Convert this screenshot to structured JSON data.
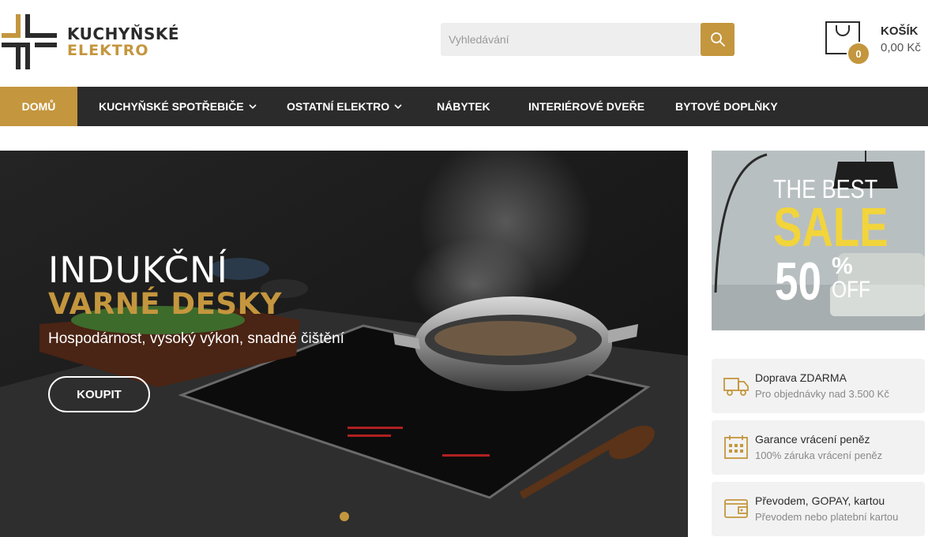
{
  "header": {
    "logo": {
      "line1": "KUCHYŇSKÉ",
      "line2": "ELEKTRO"
    },
    "search": {
      "placeholder": "Vyhledávání"
    },
    "cart": {
      "title": "KOŠÍK",
      "amount": "0,00 Kč",
      "count": "0"
    }
  },
  "nav": {
    "items": [
      {
        "label": "DOMŮ",
        "active": true,
        "dropdown": false
      },
      {
        "label": "KUCHYŇSKÉ SPOTŘEBIČE",
        "active": false,
        "dropdown": true
      },
      {
        "label": "OSTATNÍ ELEKTRO",
        "active": false,
        "dropdown": true
      },
      {
        "label": "NÁBYTEK",
        "active": false,
        "dropdown": false
      },
      {
        "label": "INTERIÉROVÉ DVEŘE",
        "active": false,
        "dropdown": false
      },
      {
        "label": "BYTOVÉ DOPLŇKY",
        "active": false,
        "dropdown": false
      }
    ]
  },
  "hero": {
    "title_line1": "INDUKČNÍ",
    "title_line2": "VARNÉ DESKY",
    "subtitle": "Hospodárnost, vysoký výkon, snadné čištění",
    "button": "KOUPIT"
  },
  "sale_banner": {
    "line1": "THE BEST",
    "line2": "SALE",
    "percent": "50",
    "percent_sign": "%",
    "off": "OFF"
  },
  "info_boxes": [
    {
      "icon": "truck-icon",
      "title": "Doprava ZDARMA",
      "text": "Pro objednávky nad 3.500 Kč"
    },
    {
      "icon": "calendar-icon",
      "title": "Garance vrácení peněz",
      "text": "100% záruka vrácení peněz"
    },
    {
      "icon": "wallet-icon",
      "title": "Převodem, GOPAY, kartou",
      "text": "Převodem nebo platební kartou"
    }
  ],
  "colors": {
    "accent": "#c4963e",
    "nav_bg": "#2b2b2b",
    "sale_yellow": "#f2d43b"
  }
}
